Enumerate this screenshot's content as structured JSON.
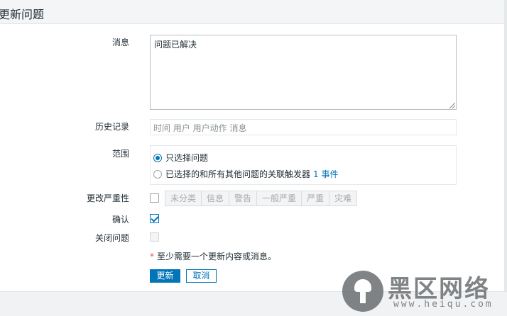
{
  "header": {
    "title": "更新问题"
  },
  "form": {
    "message": {
      "label": "消息",
      "value": "问题已解决"
    },
    "history": {
      "label": "历史记录",
      "columns_text": "时间 用户 用户动作 消息"
    },
    "scope": {
      "label": "范围",
      "options": [
        {
          "label": "只选择问题",
          "checked": true
        },
        {
          "label": "已选择的和所有其他问题的关联触发器",
          "link": "1 事件",
          "checked": false
        }
      ]
    },
    "severity": {
      "label": "更改严重性",
      "checked": false,
      "levels": [
        "未分类",
        "信息",
        "警告",
        "一般严重",
        "严重",
        "灾难"
      ]
    },
    "acknowledge": {
      "label": "确认",
      "checked": true
    },
    "close": {
      "label": "关闭问题",
      "checked": false,
      "disabled": true
    },
    "note": {
      "star": "*",
      "text": "至少需要一个更新内容或消息。"
    },
    "buttons": {
      "update": "更新",
      "cancel": "取消"
    }
  },
  "watermark": {
    "text": "黑区网络",
    "url": "www.heiqu.com"
  },
  "colors": {
    "accent": "#0275b8",
    "required": "#e45959"
  }
}
